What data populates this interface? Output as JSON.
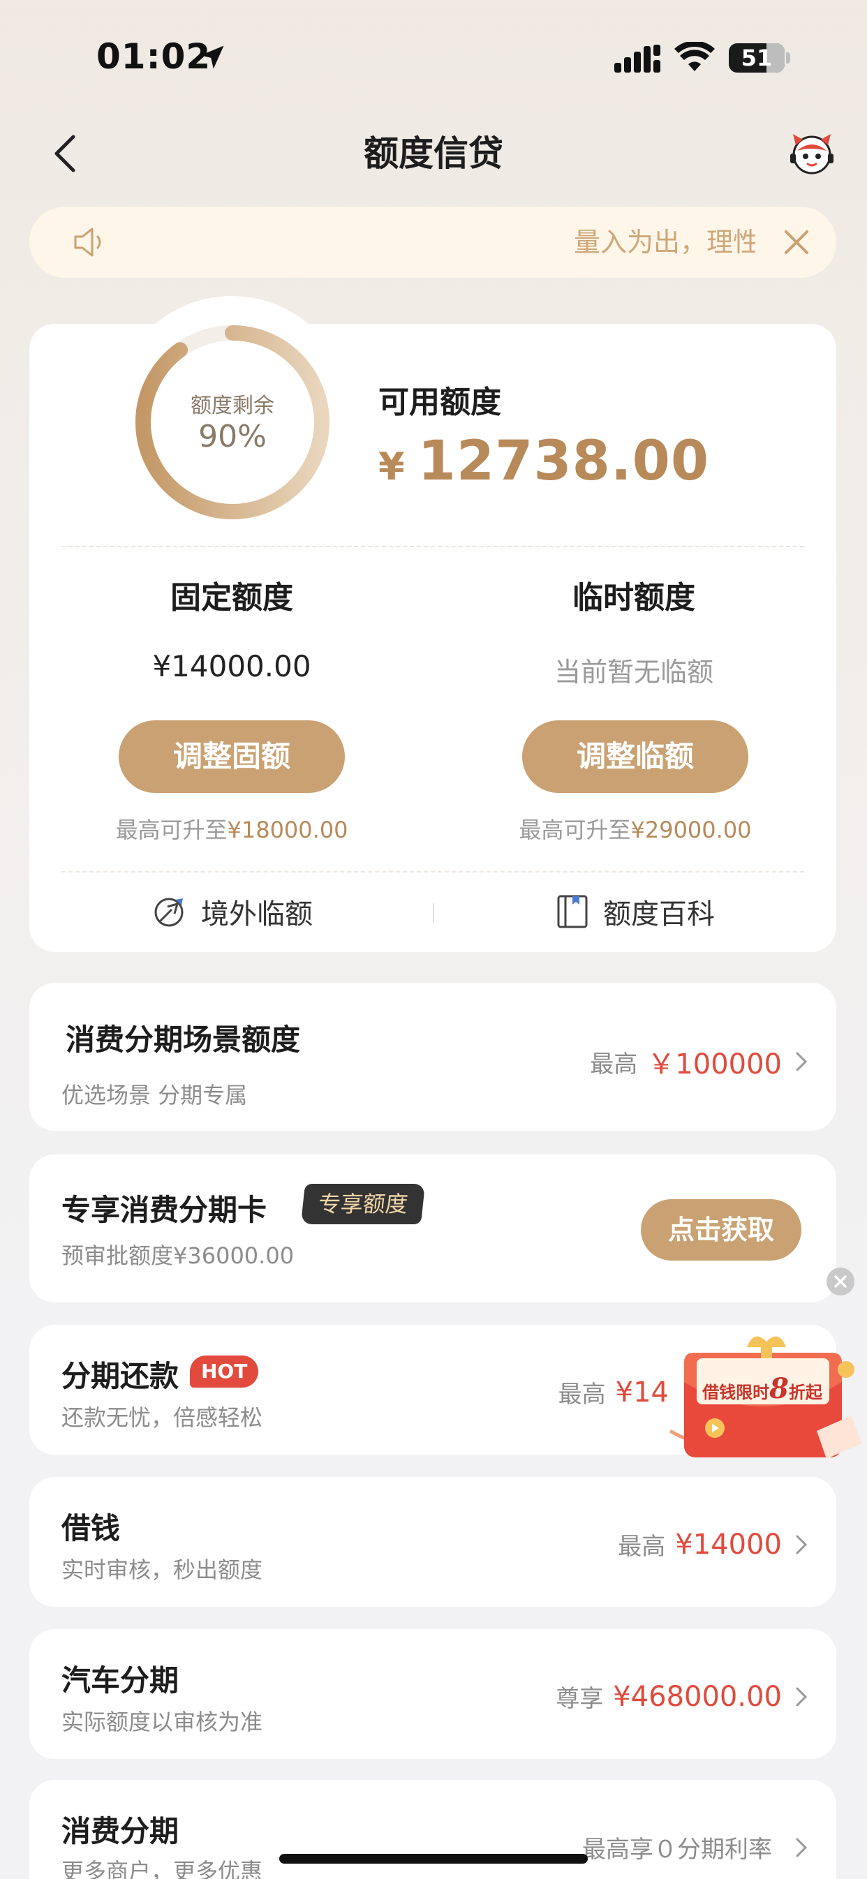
{
  "status_bar": {
    "time": "01:02",
    "battery": "51"
  },
  "nav": {
    "title": "额度信贷"
  },
  "notice": {
    "text": "量入为出，理性消费"
  },
  "credit": {
    "ring_label": "额度剩余",
    "ring_percent": "90%",
    "remaining_fraction": 0.9,
    "available_label": "可用额度",
    "available_currency": "¥",
    "available_amount": "12738.00",
    "fixed": {
      "title": "固定额度",
      "value": "¥14000.00",
      "button": "调整固额",
      "hint_prefix": "最高可升至",
      "hint_amount": "¥18000.00"
    },
    "temp": {
      "title": "临时额度",
      "value": "当前暂无临额",
      "button": "调整临额",
      "hint_prefix": "最高可升至",
      "hint_amount": "¥29000.00"
    },
    "links": {
      "overseas": "境外临额",
      "wiki": "额度百科"
    }
  },
  "cards": {
    "scene": {
      "title": "消费分期场景额度",
      "sub": "优选场景 分期专属",
      "prefix": "最高",
      "amount": "￥100000"
    },
    "exclusive": {
      "title": "专享消费分期卡",
      "tag": "专享额度",
      "sub": "预审批额度¥36000.00",
      "button": "点击获取"
    },
    "installment_repay": {
      "title": "分期还款",
      "tag": "HOT",
      "sub": "还款无忧，倍感轻松",
      "prefix": "最高",
      "amount": "¥14"
    },
    "borrow": {
      "title": "借钱",
      "sub": "实时审核，秒出额度",
      "prefix": "最高",
      "amount": "¥14000"
    },
    "car": {
      "title": "汽车分期",
      "sub": "实际额度以审核为准",
      "prefix": "尊享",
      "amount": "¥468000.00"
    },
    "consumer": {
      "title": "消费分期",
      "sub": "更多商户，更多优惠",
      "prefix": "最高享０分期利率"
    }
  },
  "promo": {
    "text_before": "借钱限时",
    "text_big": "8",
    "text_after": "折起"
  },
  "colors": {
    "gold": "#c9a172",
    "gold_text": "#b88a5a",
    "red": "#e14a3c",
    "notice_bg": "#fdf6e9"
  }
}
